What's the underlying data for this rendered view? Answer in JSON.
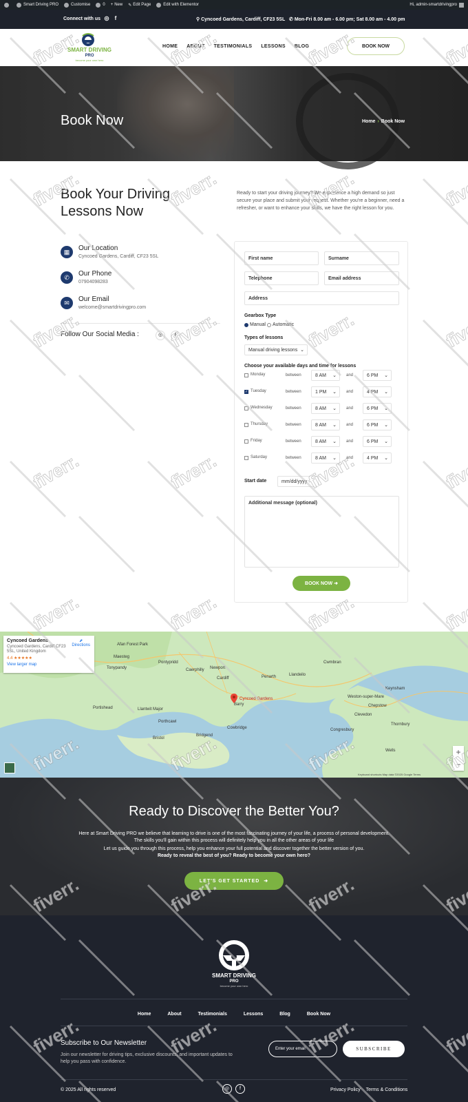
{
  "admin_bar": {
    "items": [
      "Smart Driving PRO",
      "Customise",
      "0",
      "New",
      "Edit Page",
      "Edit with Elementor"
    ],
    "greeting": "Hi, admin-smartdrivingpro"
  },
  "topbar": {
    "connect": "Connect with us",
    "address": "Cyncoed Gardens, Cardiff, CF23 5SL",
    "hours": "Mon-Fri 8.00 am - 6.00 pm; Sat 8.00 am - 4.00 pm"
  },
  "header": {
    "logo_line1": "SMART DRIVING",
    "logo_line2": "PRO",
    "logo_tagline": "become your own hero",
    "nav": [
      "HOME",
      "ABOUT",
      "TESTIMONIALS",
      "LESSONS",
      "BLOG"
    ],
    "book_now": "BOOK NOW"
  },
  "hero": {
    "title": "Book Now",
    "breadcrumb_home": "Home",
    "breadcrumb_current": "Book Now"
  },
  "intro": {
    "title": "Book Your Driving Lessons Now",
    "text": "Ready to start your driving journey? We experience a high demand so just secure your place and submit your request. Whether you're a beginner, need a refresher, or want to enhance your skills, we have the right lesson for you."
  },
  "contact": {
    "location_title": "Our Location",
    "location_value": "Cyncoed Gardens, Cardiff, CF23 5SL",
    "phone_title": "Our Phone",
    "phone_value": "07904098283",
    "email_title": "Our Email",
    "email_value": "welcome@smartdrivingpro.com",
    "follow": "Follow Our Social Media :"
  },
  "form": {
    "first_name": "First name",
    "surname": "Surname",
    "telephone": "Telephone",
    "email": "Email address",
    "address": "Address",
    "gearbox_label": "Gearbox Type",
    "gearbox_manual": "Manual",
    "gearbox_automatic": "Automatic",
    "gearbox_selected": "Manual",
    "lesson_type_label": "Types of lessons",
    "lesson_type_value": "Manual driving lessons",
    "days_label": "Choose your available days and time for lessons",
    "between": "between",
    "and": "and",
    "days": [
      {
        "day": "Monday",
        "checked": false,
        "from": "8 AM",
        "to": "6 PM"
      },
      {
        "day": "Tuesday",
        "checked": true,
        "from": "1 PM",
        "to": "4 PM"
      },
      {
        "day": "Wednesday",
        "checked": false,
        "from": "8 AM",
        "to": "6 PM"
      },
      {
        "day": "Thursday",
        "checked": false,
        "from": "8 AM",
        "to": "6 PM"
      },
      {
        "day": "Friday",
        "checked": false,
        "from": "8 AM",
        "to": "6 PM"
      },
      {
        "day": "Saturday",
        "checked": false,
        "from": "8 AM",
        "to": "4 PM"
      }
    ],
    "start_date_label": "Start date",
    "start_date_placeholder": "mm/dd/yyyy",
    "message_placeholder": "Additional message (optional)",
    "submit": "BOOK NOW"
  },
  "map": {
    "place": "Cyncoed Gardens",
    "address": "Cyncoed Gardens, Cardiff CF23 5SL, United Kingdom",
    "rating": "4.4",
    "stars": "★★★★★",
    "larger_map": "View larger map",
    "directions": "Directions",
    "pin_label": "Cyncoed Gardens",
    "labels": [
      "Afan Forest Park",
      "Maesteg",
      "Tonypandy",
      "Pontypridd",
      "Caerphilly",
      "Newport",
      "Cardiff",
      "Penarth",
      "Barry",
      "Cowbridge",
      "Bridgend",
      "Porthcawl",
      "Llantwit Major",
      "Portishead",
      "Bristol",
      "Clevedon",
      "Weston-super-Mare",
      "Thornbury",
      "Keynsham",
      "Chepstow",
      "Cwmbran",
      "Llandeilo",
      "Wells",
      "Congresbury"
    ],
    "attribution": "Keyboard shortcuts  Map data ©2025 Google  Terms"
  },
  "cta": {
    "title": "Ready to Discover the Better You?",
    "p1": "Here at Smart Driving PRO we believe that learning to drive is one of the most fascinating journey of your life, a process of personal development. The skills you'll gain within this process will definitely help you in all the other areas of your life",
    "p2": "Let us guide you through this process, help you enhance your full potential and discover together the better version of you.",
    "p3": "Ready to reveal the best of you? Ready to become your own hero?",
    "button": "LET'S GET STARTED"
  },
  "footer": {
    "logo_line1": "SMART DRIVING",
    "logo_line2": "PRO",
    "logo_tagline": "become your own hero",
    "nav": [
      "Home",
      "About",
      "Testimonials",
      "Lessons",
      "Blog",
      "Book Now"
    ],
    "newsletter_title": "Subscribe to Our Newsletter",
    "newsletter_text": "Join our newsletter for driving tips, exclusive discounts, and important updates to help you pass with confidence.",
    "newsletter_placeholder": "Enter your email",
    "subscribe": "SUBSCRIBE",
    "copyright": "© 2025 All rights reserved",
    "privacy": "Privacy Policy",
    "terms": "Terms & Conditions"
  },
  "watermark": "fiverr.",
  "colors": {
    "navy": "#1e3a6e",
    "green": "#7cb342",
    "dark": "#1f232d"
  }
}
